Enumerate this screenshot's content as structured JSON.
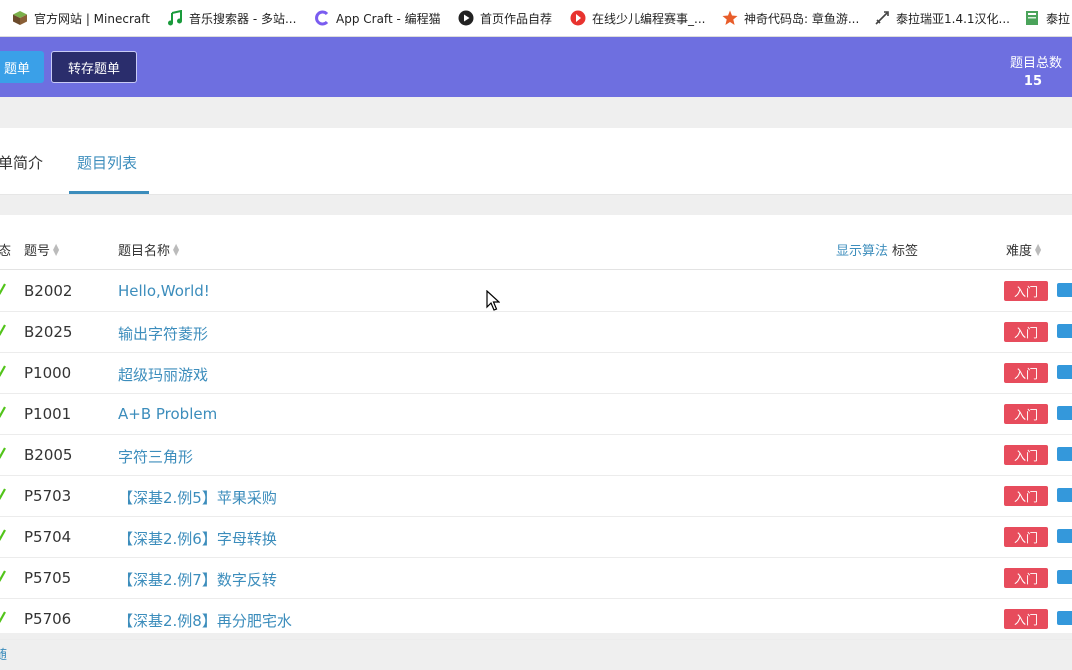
{
  "bookmarks": [
    {
      "label": "官方网站 | Minecraft",
      "icon": "minecraft-block-icon"
    },
    {
      "label": "音乐搜索器 - 多站...",
      "icon": "music-note-icon"
    },
    {
      "label": "App Craft - 编程猫",
      "icon": "appcraft-logo-icon"
    },
    {
      "label": "首页作品自荐",
      "icon": "play-circle-icon"
    },
    {
      "label": "在线少儿编程赛事_...",
      "icon": "red-circle-icon"
    },
    {
      "label": "神奇代码岛: 章鱼游...",
      "icon": "orange-star-icon"
    },
    {
      "label": "泰拉瑞亚1.4.1汉化...",
      "icon": "sword-icon"
    },
    {
      "label": "泰拉",
      "icon": "book-icon"
    }
  ],
  "header": {
    "partial_button": "题单",
    "save_button": "转存题单",
    "count_label": "题目总数",
    "count_value": "15"
  },
  "tabs": {
    "intro": "单简介",
    "list": "题目列表",
    "active": "list"
  },
  "table": {
    "headers": {
      "status": "态",
      "id": "题号",
      "name": "题目名称",
      "show_algo": "显示算法",
      "tags": "标签",
      "difficulty": "难度"
    },
    "rows": [
      {
        "id": "B2002",
        "title": "Hello,World!",
        "difficulty": "入门"
      },
      {
        "id": "B2025",
        "title": "输出字符菱形",
        "difficulty": "入门"
      },
      {
        "id": "P1000",
        "title": "超级玛丽游戏",
        "difficulty": "入门"
      },
      {
        "id": "P1001",
        "title": "A+B Problem",
        "difficulty": "入门"
      },
      {
        "id": "B2005",
        "title": "字符三角形",
        "difficulty": "入门"
      },
      {
        "id": "P5703",
        "title": "【深基2.例5】苹果采购",
        "difficulty": "入门"
      },
      {
        "id": "P5704",
        "title": "【深基2.例6】字母转换",
        "difficulty": "入门"
      },
      {
        "id": "P5705",
        "title": "【深基2.例7】数字反转",
        "difficulty": "入门"
      },
      {
        "id": "P5706",
        "title": "【深基2.例8】再分肥宅水",
        "difficulty": "入门"
      }
    ]
  },
  "footer": {
    "fragment": "随"
  },
  "colors": {
    "header_bg": "#6e6fe0",
    "accent_link": "#3c8dbc",
    "difficulty_badge": "#e74c5c",
    "check_green": "#52c41a"
  }
}
